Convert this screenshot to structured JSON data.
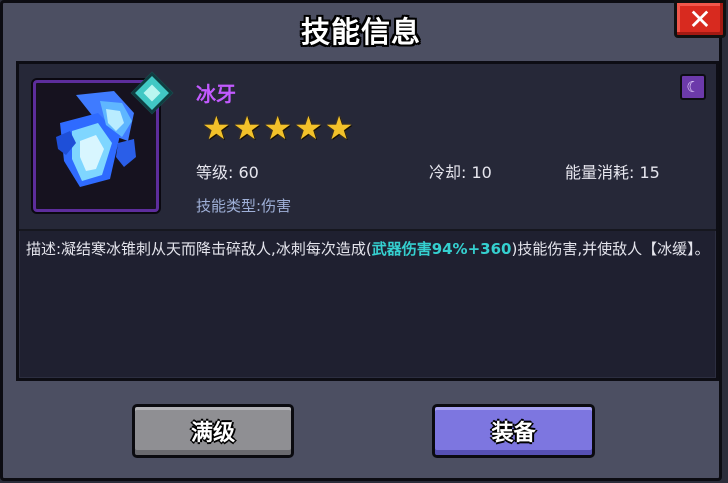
{
  "window": {
    "title": "技能信息",
    "close_label": "✕"
  },
  "skill": {
    "name": "冰牙",
    "stars": [
      "★",
      "★",
      "★",
      "★",
      "★"
    ],
    "level_label": "等级:",
    "level_value": "60",
    "cooldown_label": "冷却:",
    "cooldown_value": "10",
    "energy_label": "能量消耗:",
    "energy_value": "15",
    "type_label": "技能类型:",
    "type_value": "伤害",
    "element_icon": "moon-icon"
  },
  "description": {
    "prefix": "描述:凝结寒冰锥刺从天而降击碎敌人,冰刺每次造成(",
    "highlight": "武器伤害94%+360",
    "suffix": ")技能伤害,并使敌人【冰缓】。"
  },
  "buttons": {
    "max_label": "满级",
    "equip_label": "装备"
  },
  "colors": {
    "skill_name": "#c25aff",
    "highlight": "#35d0d0",
    "star": "#f2c12a"
  }
}
